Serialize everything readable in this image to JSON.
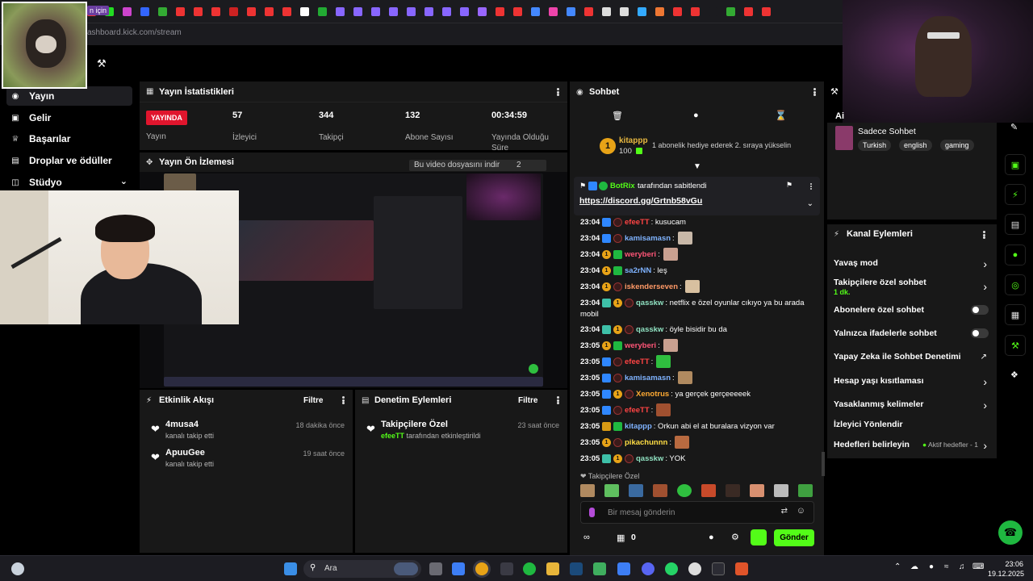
{
  "browser": {
    "url": "ashboard.kick.com/stream",
    "kick_tab_label": "n için"
  },
  "sidebar": {
    "items": [
      {
        "label": "Yayın",
        "icon": "broadcast-icon",
        "active": true
      },
      {
        "label": "Gelir",
        "icon": "money-icon"
      },
      {
        "label": "Başarılar",
        "icon": "trophy-icon"
      },
      {
        "label": "Droplar ve ödüller",
        "icon": "gift-icon"
      },
      {
        "label": "Stüdyo",
        "icon": "studio-icon",
        "expandable": true
      }
    ]
  },
  "stats": {
    "title": "Yayın İstatistikleri",
    "status_badge": "YAYINDA",
    "status_label": "Yayın",
    "viewers": {
      "value": "57",
      "label": "İzleyici"
    },
    "followers": {
      "value": "344",
      "label": "Takipçi"
    },
    "subs": {
      "value": "132",
      "label": "Abone Sayısı"
    },
    "uptime": {
      "value": "00:34:59",
      "label": "Yayında Olduğu Süre"
    }
  },
  "preview": {
    "title": "Yayın Ön İzlemesi",
    "download_hint": "Bu video dosyasını indir",
    "page_counter": "2"
  },
  "activity": {
    "title": "Etkinlik Akışı",
    "filter": "Filtre",
    "items": [
      {
        "name": "4musa4",
        "sub": "kanalı takip etti",
        "time": "18 dakika önce"
      },
      {
        "name": "ApuuGee",
        "sub": "kanalı takip etti",
        "time": "19 saat önce"
      }
    ]
  },
  "moderation": {
    "title": "Denetim Eylemleri",
    "filter": "Filtre",
    "items": [
      {
        "name": "Takipçilere Özel",
        "actor": "efeeTT",
        "sub": "tarafından etkinleştirildi",
        "time": "23 saat önce"
      }
    ]
  },
  "chat": {
    "title": "Sohbet",
    "gift_user": "kitappp",
    "gift_count": "100",
    "gift_text": "1 abonelik hediye ederek 2. sıraya yükselin",
    "gift_rank": "1",
    "pinned_by": "BotRix",
    "pinned_suffix": "tarafından sabitlendi",
    "pinned_link": "https://discord.gg/Grtnb58vGu",
    "messages": [
      {
        "time": "23:04",
        "user": "efeeTT",
        "color": "#ff4444",
        "text": ": kusucam",
        "badges": [
          "blue",
          "red"
        ]
      },
      {
        "time": "23:04",
        "user": "kamisamasn",
        "color": "#7fb3ff",
        "text": ":",
        "badges": [
          "blue",
          "red"
        ],
        "emote": "#c8b8a8"
      },
      {
        "time": "23:04",
        "user": "weryberi",
        "color": "#ff5577",
        "text": ":",
        "badges": [
          "gold",
          "green"
        ],
        "emote": "#c9a090"
      },
      {
        "time": "23:04",
        "user": "sa2rNN",
        "color": "#7fb3ff",
        "text": ": leş",
        "badges": [
          "gold",
          "green"
        ]
      },
      {
        "time": "23:04",
        "user": "iskenderseven",
        "color": "#ff9966",
        "text": ":",
        "badges": [
          "gold",
          "red"
        ],
        "emote": "#d8c0a0"
      },
      {
        "time": "23:04",
        "user": "qasskw",
        "color": "#8fe0c0",
        "text": ": netflix e özel oyunlar cıkıyo ya bu arada",
        "text2": "mobil",
        "badges": [
          "teal",
          "gold",
          "red"
        ]
      },
      {
        "time": "23:04",
        "user": "qasskw",
        "color": "#8fe0c0",
        "text": ": öyle bisidir bu da",
        "badges": [
          "teal",
          "gold",
          "red"
        ]
      },
      {
        "time": "23:05",
        "user": "weryberi",
        "color": "#ff5577",
        "text": ":",
        "badges": [
          "gold",
          "green"
        ],
        "emote": "#c9a090"
      },
      {
        "time": "23:05",
        "user": "efeeTT",
        "color": "#ff4444",
        "text": ":",
        "badges": [
          "blue",
          "red"
        ],
        "emote": "#2fbf3f"
      },
      {
        "time": "23:05",
        "user": "kamisamasn",
        "color": "#7fb3ff",
        "text": ":",
        "badges": [
          "blue",
          "red"
        ],
        "emote": "#b08a60"
      },
      {
        "time": "23:05",
        "user": "Xenotrus",
        "color": "#ffaa33",
        "text": ": ya gerçek gerçeeeeek",
        "badges": [
          "blue",
          "gold",
          "red"
        ]
      },
      {
        "time": "23:05",
        "user": "efeeTT",
        "color": "#ff4444",
        "text": ":",
        "badges": [
          "blue",
          "red"
        ],
        "emote": "#a05030"
      },
      {
        "time": "23:05",
        "user": "kitappp",
        "color": "#7fb3ff",
        "text": ": Orkun abi el at buralara vizyon var",
        "badges": [
          "crown",
          "green"
        ]
      },
      {
        "time": "23:05",
        "user": "pikachunnn",
        "color": "#ffdd44",
        "text": ":",
        "badges": [
          "gold",
          "red"
        ],
        "emote": "#b86a40"
      },
      {
        "time": "23:05",
        "user": "qasskw",
        "color": "#8fe0c0",
        "text": ": YOK",
        "badges": [
          "teal",
          "gold",
          "red"
        ]
      }
    ],
    "followers_only_label": "Takipçilere Özel",
    "input_placeholder": "Bir mesaj gönderin",
    "points": "0",
    "send_label": "Gönder"
  },
  "channel_info": {
    "heading": "Ai",
    "title": "Sadece Sohbet",
    "tags": [
      "Turkish",
      "english",
      "gaming"
    ]
  },
  "channel_actions": {
    "title": "Kanal Eylemleri",
    "items": [
      {
        "label": "Yavaş mod",
        "control": "chevron"
      },
      {
        "label": "Takipçilere özel sohbet",
        "sub": "1 dk.",
        "control": "chevron"
      },
      {
        "label": "Abonelere özel sohbet",
        "control": "toggle"
      },
      {
        "label": "Yalnızca ifadelerle sohbet",
        "control": "toggle"
      },
      {
        "label": "Yapay Zeka ile Sohbet Denetimi",
        "control": "external"
      },
      {
        "label": "Hesap yaşı kısıtlaması",
        "control": "chevron"
      },
      {
        "label": "Yasaklanmış kelimeler",
        "control": "chevron"
      },
      {
        "label": "İzleyici Yönlendir",
        "control": "none"
      },
      {
        "label": "Hedefleri belirleyin",
        "control": "chevron",
        "status": "Aktif hedefler - 1"
      }
    ]
  },
  "taskbar": {
    "search_label": "Ara",
    "time": "23:06",
    "date": "19.12.2025"
  },
  "colors": {
    "accent": "#53fc18",
    "live": "#e0152d",
    "panel": "#181818"
  }
}
